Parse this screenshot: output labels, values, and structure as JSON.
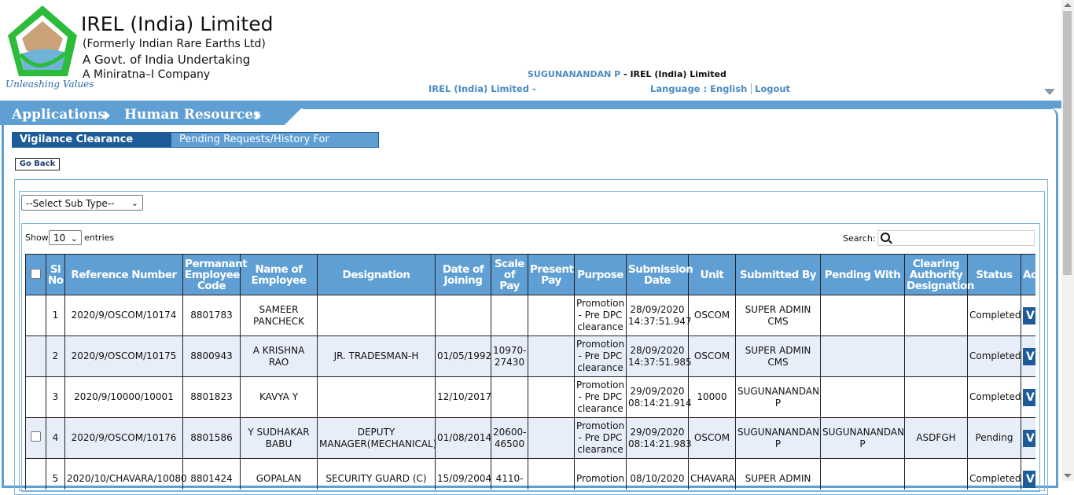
{
  "brand": {
    "title": "IREL (India) Limited",
    "line1": "(Formerly Indian Rare Earths Ltd)",
    "line2": "A Govt. of India Undertaking",
    "line3": "A Miniratna–I Company",
    "tagline": "Unleashing Values"
  },
  "user": {
    "name": "SUGUNANANDAN P",
    "separator": " - ",
    "org": "IREL (India) Limited",
    "org_line": "IREL (India) Limited  -",
    "language": "Language : English",
    "logout": "Logout"
  },
  "menu": {
    "applications": "Applications",
    "human_resources": "Human Resources"
  },
  "tabs": {
    "tab1": "Vigilance Clearance Requests",
    "tab2": "Pending Requests/History For Approver"
  },
  "go_back": "Go Back",
  "filter": {
    "subtype": "--Select Sub Type--"
  },
  "datatable": {
    "show": "Show",
    "entries_value": "10",
    "entries": "entries",
    "search_label": "Search:"
  },
  "table": {
    "headers": [
      "Sl No",
      "Reference Number",
      "Permanant Employee Code",
      "Name of Employee",
      "Designation",
      "Date of Joining",
      "Scale of Pay",
      "Present Pay",
      "Purpose",
      "Submission Date",
      "Unit",
      "Submitted By",
      "Pending With",
      "Clearing Authority Designation",
      "Status",
      "Action"
    ],
    "rows": [
      [
        "1",
        "2020/9/OSCOM/10174",
        "8801783",
        "SAMEER PANCHECK",
        "",
        "",
        "",
        "",
        "Promotion - Pre DPC clearance",
        "28/09/2020 14:37:51.947",
        "OSCOM",
        "SUPER ADMIN CMS",
        "",
        "",
        "Completed",
        "V"
      ],
      [
        "2",
        "2020/9/OSCOM/10175",
        "8800943",
        "A KRISHNA RAO",
        "JR. TRADESMAN-H",
        "01/05/1992",
        "10970-27430",
        "",
        "Promotion - Pre DPC clearance",
        "28/09/2020 14:37:51.985",
        "OSCOM",
        "SUPER ADMIN CMS",
        "",
        "",
        "Completed",
        "V"
      ],
      [
        "3",
        "2020/9/10000/10001",
        "8801823",
        "KAVYA Y",
        "",
        "12/10/2017",
        "",
        "",
        "Promotion - Pre DPC clearance",
        "29/09/2020 08:14:21.914",
        "10000",
        "SUGUNANANDAN P",
        "",
        "",
        "Completed",
        "V"
      ],
      [
        "4",
        "2020/9/OSCOM/10176",
        "8801586",
        "Y SUDHAKAR BABU",
        "DEPUTY MANAGER(MECHANICAL)",
        "01/08/2014",
        "20600-46500",
        "",
        "Promotion - Pre DPC clearance",
        "29/09/2020 08:14:21.983",
        "OSCOM",
        "SUGUNANANDAN P",
        "SUGUNANANDAN P",
        "ASDFGH",
        "Pending",
        "V"
      ],
      [
        "5",
        "2020/10/CHAVARA/10080",
        "8801424",
        "GOPALAN",
        "SECURITY GUARD (C)",
        "15/09/2004",
        "4110-",
        "",
        "Promotion",
        "08/10/2020",
        "CHAVARA",
        "SUPER ADMIN",
        "",
        "",
        "Completed",
        "V"
      ]
    ]
  }
}
